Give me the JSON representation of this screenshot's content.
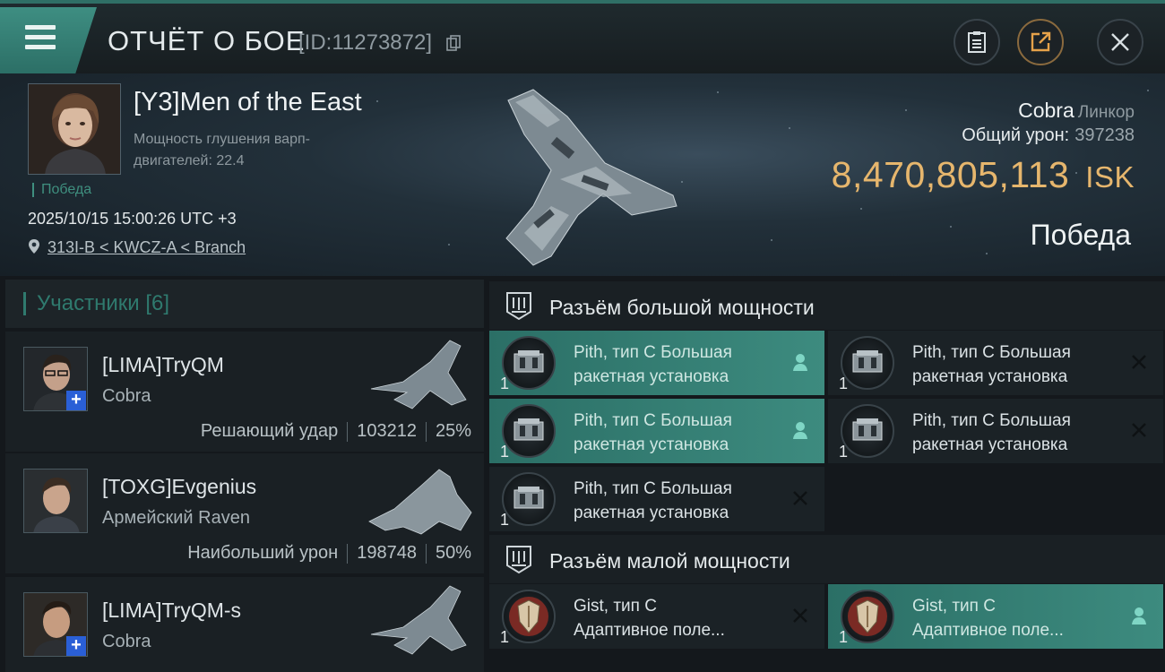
{
  "header": {
    "title": "ОТЧЁТ О БОЕ",
    "report_id": "[ID:11273872]",
    "icons": {
      "menu": "menu-icon",
      "copy": "copy-icon",
      "clipboard": "clipboard-icon",
      "share": "share-icon",
      "close": "close-icon"
    }
  },
  "hero": {
    "player_name": "[Y3]Men of the East",
    "warp_scram_label": "Мощность глушения варп-двигателей: 22.4",
    "result_tag": "Победа",
    "datetime": "2025/10/15 15:00:26 UTC +3",
    "location": "313I-B < KWCZ-A < Branch",
    "ship_name": "Cobra",
    "ship_class": "Линкор",
    "total_damage_label": "Общий урон:",
    "total_damage_value": "397238",
    "isk_value": "8,470,805,113",
    "isk_unit": "ISK",
    "outcome": "Победа"
  },
  "participants": {
    "header": "Участники [6]",
    "items": [
      {
        "name": "[LIMA]TryQM",
        "ship": "Cobra",
        "stat_label": "Решающий удар",
        "damage": "103212",
        "percent": "25%",
        "has_plus": true
      },
      {
        "name": "[TOXG]Evgenius",
        "ship": "Армейский Raven",
        "stat_label": "Наибольший урон",
        "damage": "198748",
        "percent": "50%",
        "has_plus": false
      },
      {
        "name": "[LIMA]TryQM-s",
        "ship": "Cobra",
        "stat_label": "",
        "damage": "",
        "percent": "",
        "has_plus": true
      }
    ]
  },
  "slots": {
    "high": {
      "title": "Разъём большой мощности",
      "items": [
        {
          "line1": "Pith, тип C Большая",
          "line2": "ракетная установка",
          "qty": "1",
          "status": "pilot",
          "active": true
        },
        {
          "line1": "Pith, тип C Большая",
          "line2": "ракетная установка",
          "qty": "1",
          "status": "destroyed",
          "active": false
        },
        {
          "line1": "Pith, тип C Большая",
          "line2": "ракетная установка",
          "qty": "1",
          "status": "pilot",
          "active": true
        },
        {
          "line1": "Pith, тип C Большая",
          "line2": "ракетная установка",
          "qty": "1",
          "status": "destroyed",
          "active": false
        },
        {
          "line1": "Pith, тип C Большая",
          "line2": "ракетная установка",
          "qty": "1",
          "status": "destroyed",
          "active": false
        }
      ]
    },
    "low": {
      "title": "Разъём малой мощности",
      "items": [
        {
          "line1": "Gist, тип C",
          "line2": "Адаптивное поле...",
          "qty": "1",
          "status": "destroyed",
          "active": false
        },
        {
          "line1": "Gist, тип C",
          "line2": "Адаптивное поле...",
          "qty": "1",
          "status": "pilot",
          "active": true
        }
      ]
    }
  },
  "colors": {
    "accent": "#3d8b7f",
    "isk": "#e6b66d",
    "plus_badge": "#2a5fd6"
  }
}
